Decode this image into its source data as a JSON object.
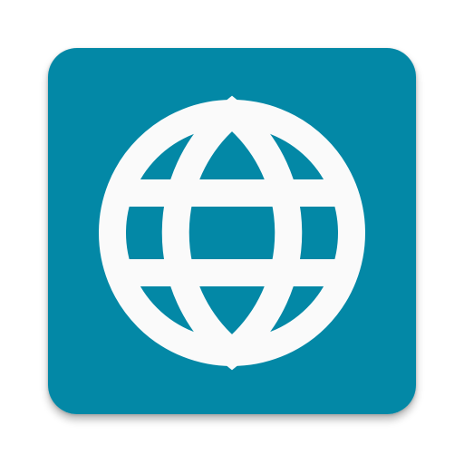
{
  "icon": {
    "name": "globe-icon",
    "background_color": "#0388A6",
    "glyph_color": "#FAFAFA"
  }
}
